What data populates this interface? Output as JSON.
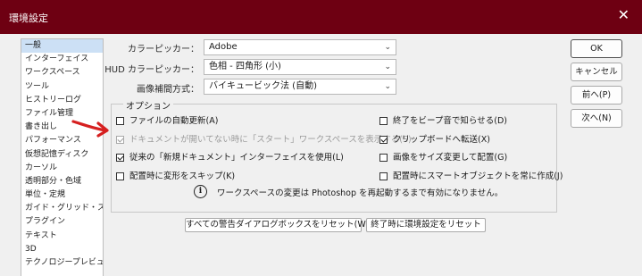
{
  "window": {
    "title": "環境設定",
    "close_label": "✕"
  },
  "sidebar": {
    "items": [
      {
        "label": "一般"
      },
      {
        "label": "インターフェイス"
      },
      {
        "label": "ワークスペース"
      },
      {
        "label": "ツール"
      },
      {
        "label": "ヒストリーログ"
      },
      {
        "label": "ファイル管理"
      },
      {
        "label": "書き出し"
      },
      {
        "label": "パフォーマンス"
      },
      {
        "label": "仮想記憶ディスク"
      },
      {
        "label": "カーソル"
      },
      {
        "label": "透明部分・色域"
      },
      {
        "label": "単位・定規"
      },
      {
        "label": "ガイド・グリッド・スライス"
      },
      {
        "label": "プラグイン"
      },
      {
        "label": "テキスト"
      },
      {
        "label": "3D"
      },
      {
        "label": "テクノロジープレビュー"
      }
    ],
    "selected_index": 0
  },
  "fields": {
    "color_picker": {
      "label": "カラーピッカー：",
      "value": "Adobe"
    },
    "hud_picker": {
      "label": "HUD カラーピッカー：",
      "value": "色相 - 四角形 (小)"
    },
    "interpolation": {
      "label": "画像補間方式：",
      "value": "バイキュービック法 (自動)"
    }
  },
  "options": {
    "group_label": "オプション",
    "left": [
      {
        "label": "ファイルの自動更新(A)",
        "checked": false,
        "disabled": false
      },
      {
        "label": "ドキュメントが開いてない時に「スタート」ワークスペースを表示する(S)",
        "checked": true,
        "disabled": true
      },
      {
        "label": "従来の「新規ドキュメント」インターフェイスを使用(L)",
        "checked": true,
        "disabled": false
      },
      {
        "label": "配置時に変形をスキップ(K)",
        "checked": false,
        "disabled": false
      }
    ],
    "right": [
      {
        "label": "終了をビープ音で知らせる(D)",
        "checked": false,
        "disabled": false
      },
      {
        "label": "クリップボードへ転送(X)",
        "checked": true,
        "disabled": false
      },
      {
        "label": "画像をサイズ変更して配置(G)",
        "checked": false,
        "disabled": false
      },
      {
        "label": "配置時にスマートオブジェクトを常に作成(J)",
        "checked": false,
        "disabled": false
      }
    ],
    "info_icon_glyph": "i",
    "info_text": "ワークスペースの変更は Photoshop を再起動するまで有効になりません。"
  },
  "buttons": {
    "ok": "OK",
    "cancel": "キャンセル",
    "prev": "前へ(P)",
    "next": "次へ(N)",
    "reset_warnings": "すべての警告ダイアログボックスをリセット(W)",
    "reset_prefs": "終了時に環境設定をリセット"
  },
  "colors": {
    "titlebar": "#6e0012",
    "annotation_arrow": "#d62020",
    "selected_item": "#cce0f5"
  }
}
